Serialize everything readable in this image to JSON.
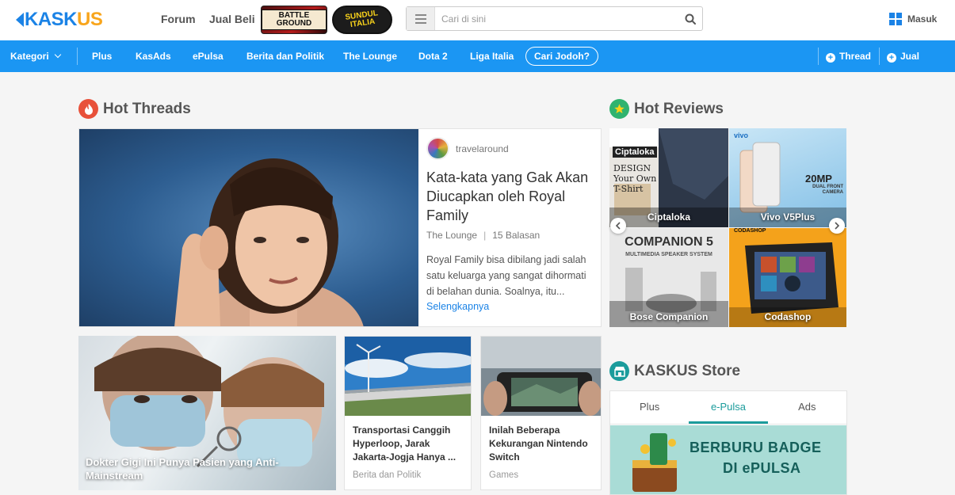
{
  "header": {
    "logo_primary": "KASK",
    "logo_accent": "US",
    "links": [
      "Forum",
      "Jual Beli"
    ],
    "promo_battle": "BATTLE GROUND",
    "promo_sundul": "SUNDUL ITALIA",
    "search_placeholder": "Cari di sini",
    "login_label": "Masuk"
  },
  "nav": {
    "kategori": "Kategori",
    "items": [
      "Plus",
      "KasAds",
      "ePulsa",
      "Berita dan Politik",
      "The Lounge",
      "Dota 2",
      "Liga Italia"
    ],
    "pill": "Cari Jodoh?",
    "thread_btn": "Thread",
    "jual_btn": "Jual"
  },
  "hot_threads": {
    "heading": "Hot Threads",
    "feature": {
      "author": "travelaround",
      "title": "Kata-kata yang Gak Akan Diucapkan oleh Royal Family",
      "category": "The Lounge",
      "replies": "15 Balasan",
      "excerpt": "Royal Family bisa dibilang jadi salah satu keluarga yang sangat dihormati di belahan dunia. Soalnya, itu...",
      "more_label": "Selengkapnya"
    },
    "cards": [
      {
        "title": "Dokter Gigi Ini Punya Pasien yang Anti-Mainstream"
      },
      {
        "title": "Transportasi Canggih Hyperloop, Jarak Jakarta-Jogja Hanya ...",
        "category": "Berita dan Politik"
      },
      {
        "title": "Inilah Beberapa Kekurangan Nintendo Switch",
        "category": "Games"
      }
    ]
  },
  "hot_reviews": {
    "heading": "Hot Reviews",
    "items": [
      {
        "caption": "Ciptaloka",
        "brand": "Ciptaloka",
        "tagline": "DESIGN Your Own T-Shirt"
      },
      {
        "caption": "Vivo V5Plus",
        "brand": "vivo",
        "tagline": "20MP",
        "subtag": "DUAL FRONT CAMERA"
      },
      {
        "caption": "Bose Companion",
        "headline": "COMPANION 5",
        "subline": "MULTIMEDIA SPEAKER SYSTEM"
      },
      {
        "caption": "Codashop",
        "brand": "CODASHOP"
      }
    ]
  },
  "store": {
    "heading": "KASKUS Store",
    "tabs": [
      "Plus",
      "e-Pulsa",
      "Ads"
    ],
    "active_tab": "e-Pulsa",
    "banner_line1": "BERBURU BADGE",
    "banner_line2": "DI ePULSA"
  },
  "colors": {
    "brand_blue": "#1b83e6",
    "brand_orange": "#f8a51c",
    "nav_blue": "#1b96f3",
    "hot_red": "#e8513a",
    "review_green": "#2fb36f",
    "store_teal": "#1b9c9c"
  },
  "icons": {
    "hot": "fire-icon",
    "reviews": "star-icon",
    "store": "store-icon",
    "search": "search-icon",
    "menu": "hamburger-icon",
    "login": "grid-icon"
  }
}
